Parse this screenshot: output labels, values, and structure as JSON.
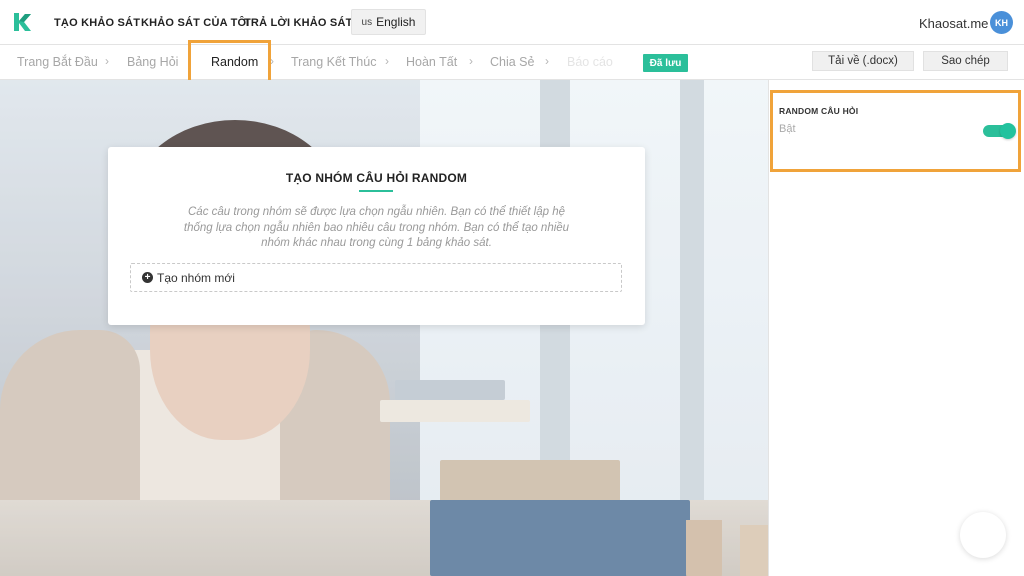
{
  "brand": {
    "accent": "#2bbf9a",
    "highlight": "#f0a33a"
  },
  "nav": {
    "create_survey": "TẠO KHẢO SÁT",
    "my_surveys": "KHẢO SÁT CỦA TÔI",
    "answer_survey": "TRẢ LỜI KHẢO SÁT",
    "language_flag": "us",
    "language": "English"
  },
  "user": {
    "name": "Khaosat.me",
    "initials": "KH"
  },
  "steps": [
    {
      "label": "Trang Bắt Đầu"
    },
    {
      "label": "Bảng Hỏi"
    },
    {
      "label": "Random"
    },
    {
      "label": "Trang Kết Thúc"
    },
    {
      "label": "Hoàn Tất"
    },
    {
      "label": "Chia Sẻ"
    },
    {
      "label": "Báo cáo"
    }
  ],
  "step_separator": "›",
  "saved_badge": "Đã lưu",
  "actions": {
    "download": "Tải về (.docx)",
    "copy": "Sao chép"
  },
  "card": {
    "title": "TẠO NHÓM CÂU HỎI RANDOM",
    "description": "Các câu trong nhóm sẽ được lựa chọn ngẫu nhiên. Bạn có thể thiết lập hệ thống lựa chọn ngẫu nhiên bao nhiêu câu trong nhóm. Bạn có thể tạo nhiều nhóm khác nhau trong cùng 1 bảng khảo sát.",
    "new_group_label": "Tạo nhóm mới",
    "plus_glyph": "+"
  },
  "panel": {
    "label": "RANDOM CÂU HỎI",
    "state": "Bật",
    "toggle_on": true
  }
}
